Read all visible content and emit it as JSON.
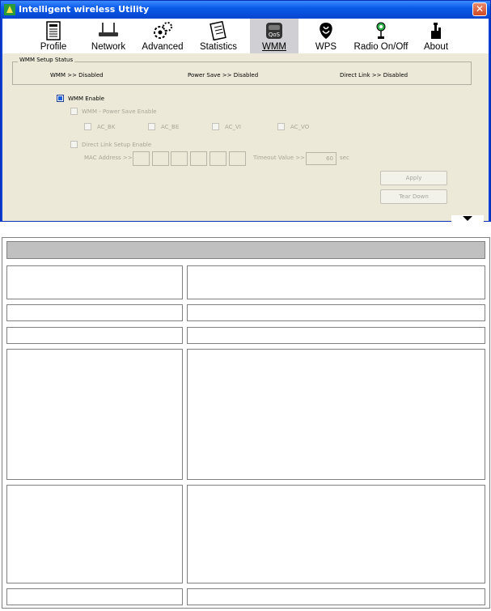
{
  "window": {
    "title": "Intelligent wireless Utility",
    "close_label": "✕"
  },
  "toolbar": {
    "items": [
      {
        "label": "Profile",
        "icon": "profile-icon"
      },
      {
        "label": "Network",
        "icon": "network-icon"
      },
      {
        "label": "Advanced",
        "icon": "advanced-icon"
      },
      {
        "label": "Statistics",
        "icon": "statistics-icon"
      },
      {
        "label": "WMM",
        "icon": "wmm-qos-icon",
        "active": true
      },
      {
        "label": "WPS",
        "icon": "wps-icon"
      },
      {
        "label": "Radio On/Off",
        "icon": "radio-icon"
      },
      {
        "label": "About",
        "icon": "about-icon"
      }
    ]
  },
  "status": {
    "legend": "WMM Setup Status",
    "wmm": "WMM >> Disabled",
    "power_save": "Power Save >> Disabled",
    "direct_link": "Direct Link >> Disabled"
  },
  "settings": {
    "wmm_enable": {
      "label": "WMM Enable",
      "checked": true
    },
    "power_save_enable": {
      "label": "WMM - Power Save Enable",
      "checked": false
    },
    "ac_options": [
      "AC_BK",
      "AC_BE",
      "AC_VI",
      "AC_VO"
    ],
    "direct_link_enable": {
      "label": "Direct Link Setup Enable",
      "checked": false
    },
    "mac_label": "MAC Address >>",
    "timeout_label": "Timeout Value >>",
    "timeout_value": "60",
    "timeout_unit": "sec",
    "apply_label": "Apply",
    "tear_down_label": "Tear Down"
  },
  "colors": {
    "title_bar": "#0a5ae8",
    "panel": "#ece9d8",
    "check_accent": "#1c5fd6",
    "table_header": "#c0c0c0"
  }
}
